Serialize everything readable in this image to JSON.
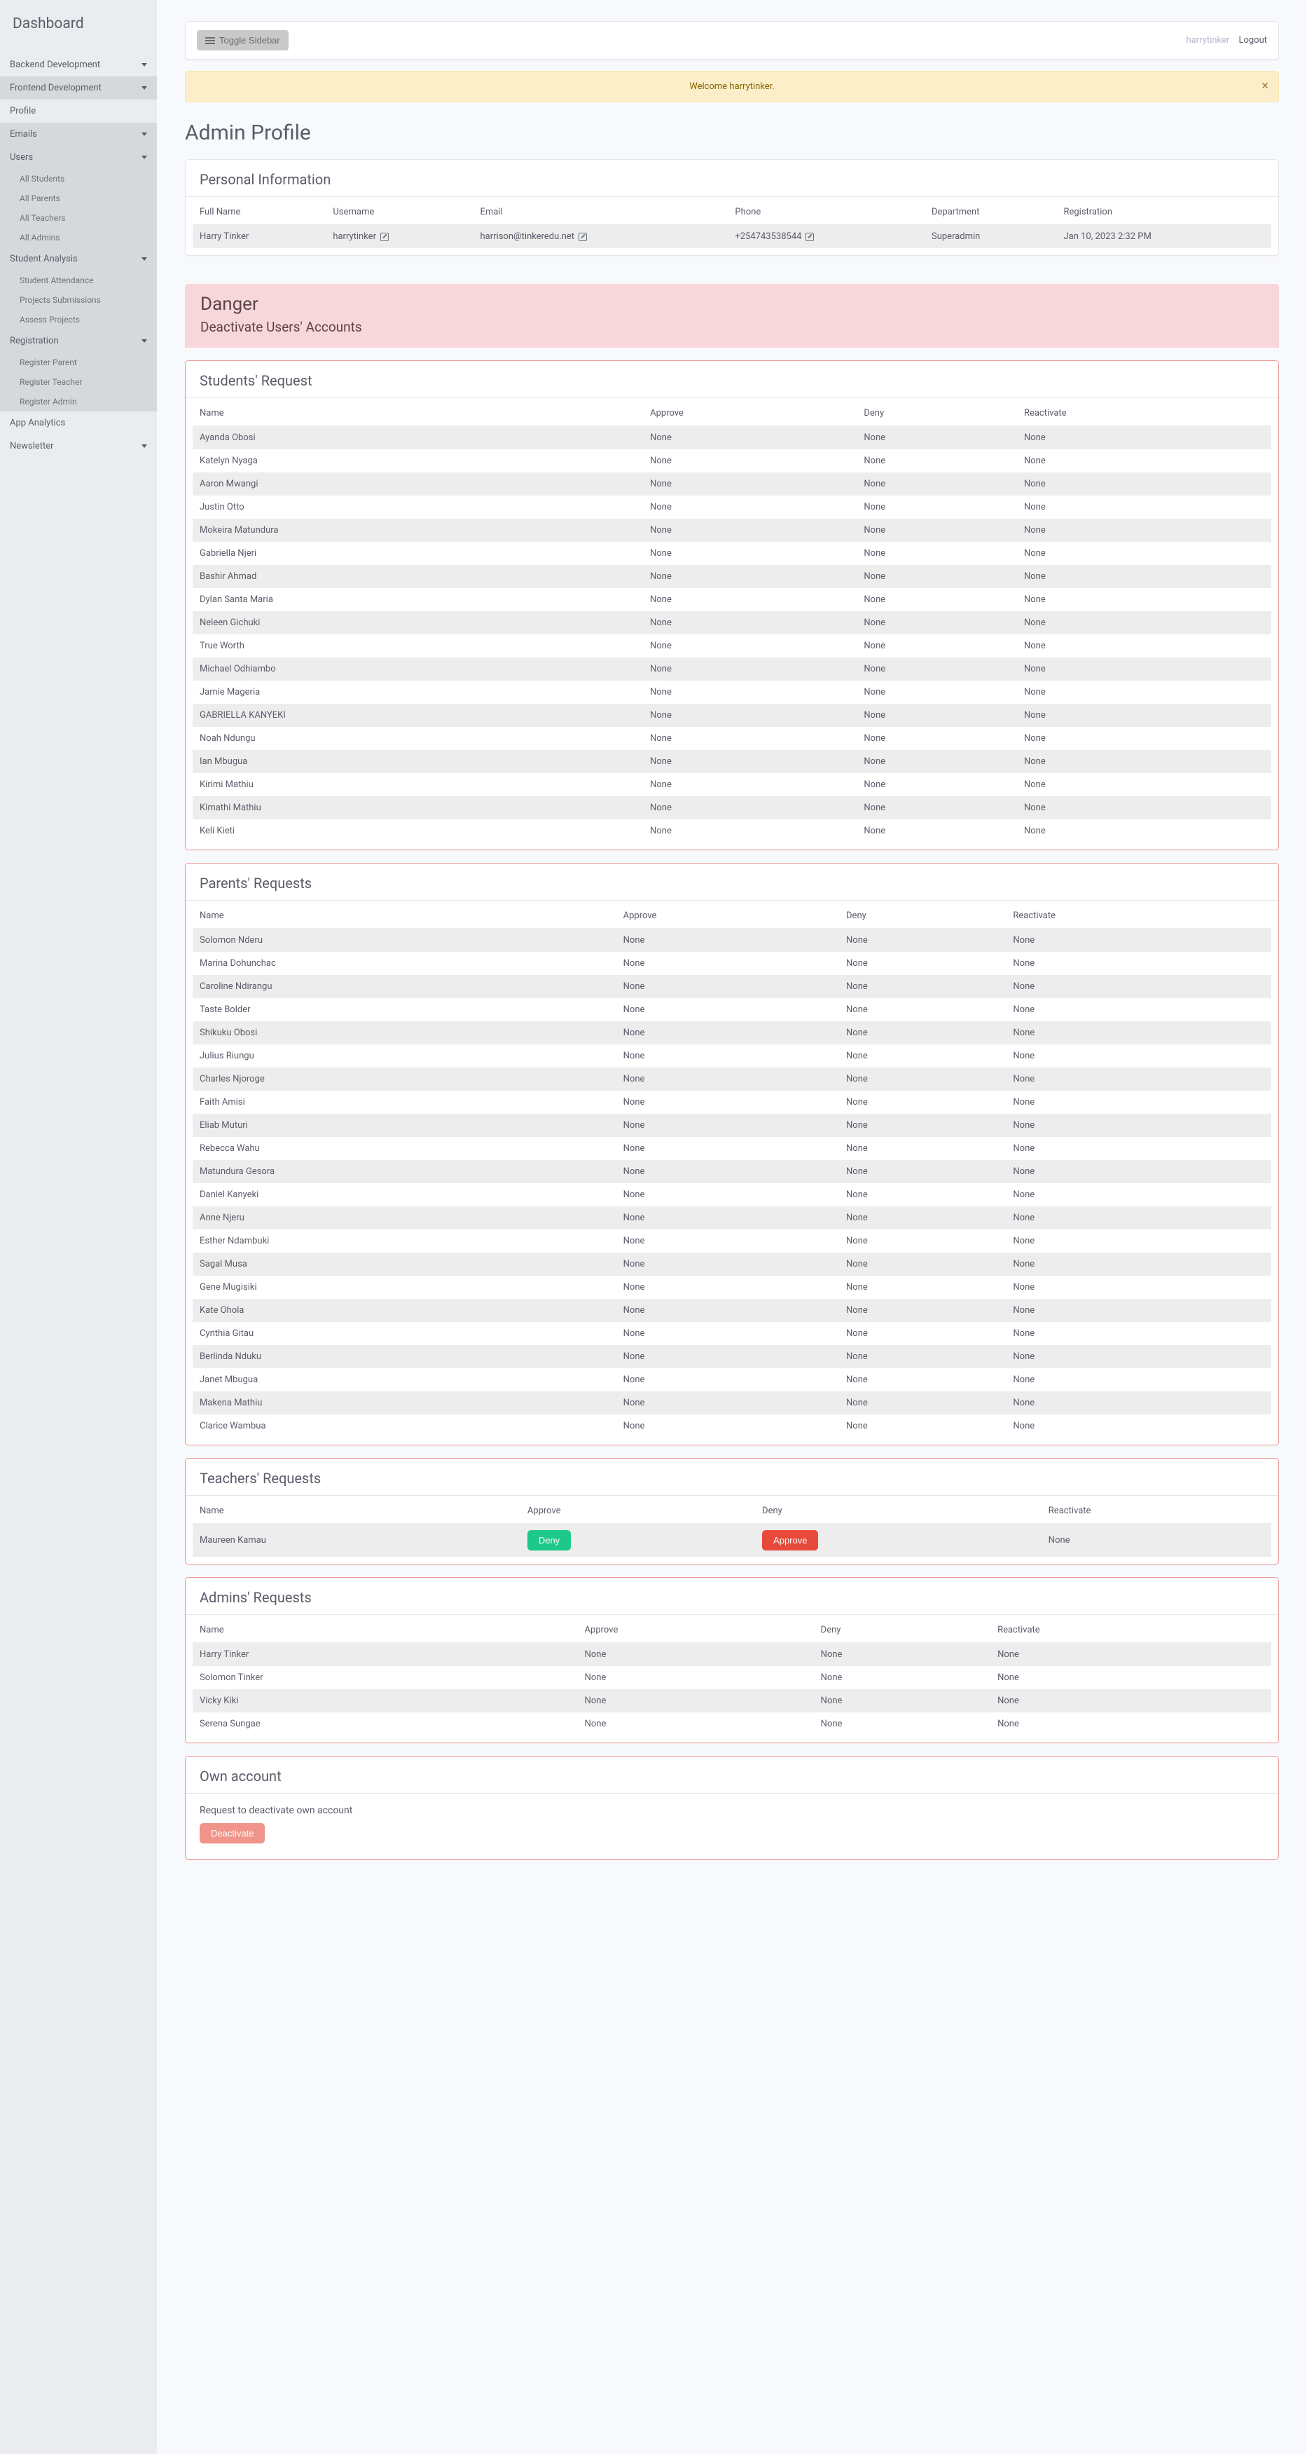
{
  "sidebar": {
    "brand": "Dashboard",
    "items": [
      {
        "label": "Backend Development",
        "caret": true,
        "kind": "plain"
      },
      {
        "label": "Frontend Development",
        "caret": true,
        "kind": "active"
      },
      {
        "label": "Profile",
        "caret": false,
        "kind": "plain"
      },
      {
        "label": "Emails",
        "caret": true,
        "kind": "active"
      },
      {
        "label": "Users",
        "caret": true,
        "kind": "expanded",
        "subs": [
          "All Students",
          "All Parents",
          "All Teachers",
          "All Admins"
        ]
      },
      {
        "label": "Student Analysis",
        "caret": true,
        "kind": "expanded",
        "subs": [
          "Student Attendance",
          "Projects Submissions",
          "Assess Projects"
        ]
      },
      {
        "label": "Registration",
        "caret": true,
        "kind": "expanded",
        "subs": [
          "Register Parent",
          "Register Teacher",
          "Register Admin"
        ]
      },
      {
        "label": "App Analytics",
        "caret": false,
        "kind": "plain"
      },
      {
        "label": "Newsletter",
        "caret": true,
        "kind": "plain"
      }
    ]
  },
  "topbar": {
    "toggle": "Toggle Sidebar",
    "user": "harrytinker",
    "logout": "Logout"
  },
  "alert": {
    "text": "Welcome harrytinker."
  },
  "page_title": "Admin Profile",
  "personal_info": {
    "title": "Personal Information",
    "headers": [
      "Full Name",
      "Username",
      "Email",
      "Phone",
      "Department",
      "Registration"
    ],
    "row": {
      "full_name": "Harry Tinker",
      "username": "harrytinker",
      "email": "harrison@tinkeredu.net",
      "phone": "+254743538544",
      "department": "Superadmin",
      "registration": "Jan 10, 2023 2:32 PM"
    }
  },
  "danger": {
    "title": "Danger",
    "subtitle": "Deactivate Users' Accounts"
  },
  "students": {
    "title": "Students' Request",
    "headers": [
      "Name",
      "Approve",
      "Deny",
      "Reactivate"
    ],
    "rows": [
      {
        "name": "Ayanda Obosi",
        "approve": "None",
        "deny": "None",
        "reactivate": "None"
      },
      {
        "name": "Katelyn Nyaga",
        "approve": "None",
        "deny": "None",
        "reactivate": "None"
      },
      {
        "name": "Aaron Mwangi",
        "approve": "None",
        "deny": "None",
        "reactivate": "None"
      },
      {
        "name": "Justin Otto",
        "approve": "None",
        "deny": "None",
        "reactivate": "None"
      },
      {
        "name": "Mokeira Matundura",
        "approve": "None",
        "deny": "None",
        "reactivate": "None"
      },
      {
        "name": "Gabriella Njeri",
        "approve": "None",
        "deny": "None",
        "reactivate": "None"
      },
      {
        "name": "Bashir Ahmad",
        "approve": "None",
        "deny": "None",
        "reactivate": "None"
      },
      {
        "name": "Dylan Santa Maria",
        "approve": "None",
        "deny": "None",
        "reactivate": "None"
      },
      {
        "name": "Neleen Gichuki",
        "approve": "None",
        "deny": "None",
        "reactivate": "None"
      },
      {
        "name": "True Worth",
        "approve": "None",
        "deny": "None",
        "reactivate": "None"
      },
      {
        "name": "Michael Odhiambo",
        "approve": "None",
        "deny": "None",
        "reactivate": "None"
      },
      {
        "name": "Jamie Mageria",
        "approve": "None",
        "deny": "None",
        "reactivate": "None"
      },
      {
        "name": "GABRIELLA KANYEKI",
        "approve": "None",
        "deny": "None",
        "reactivate": "None"
      },
      {
        "name": "Noah Ndungu",
        "approve": "None",
        "deny": "None",
        "reactivate": "None"
      },
      {
        "name": "Ian Mbugua",
        "approve": "None",
        "deny": "None",
        "reactivate": "None"
      },
      {
        "name": "Kirimi Mathiu",
        "approve": "None",
        "deny": "None",
        "reactivate": "None"
      },
      {
        "name": "Kimathi Mathiu",
        "approve": "None",
        "deny": "None",
        "reactivate": "None"
      },
      {
        "name": "Keli Kieti",
        "approve": "None",
        "deny": "None",
        "reactivate": "None"
      }
    ]
  },
  "parents": {
    "title": "Parents' Requests",
    "headers": [
      "Name",
      "Approve",
      "Deny",
      "Reactivate"
    ],
    "rows": [
      {
        "name": "Solomon Nderu",
        "approve": "None",
        "deny": "None",
        "reactivate": "None"
      },
      {
        "name": "Marina Dohunchac",
        "approve": "None",
        "deny": "None",
        "reactivate": "None"
      },
      {
        "name": "Caroline Ndirangu",
        "approve": "None",
        "deny": "None",
        "reactivate": "None"
      },
      {
        "name": "Taste Bolder",
        "approve": "None",
        "deny": "None",
        "reactivate": "None"
      },
      {
        "name": "Shikuku Obosi",
        "approve": "None",
        "deny": "None",
        "reactivate": "None"
      },
      {
        "name": "Julius Riungu",
        "approve": "None",
        "deny": "None",
        "reactivate": "None"
      },
      {
        "name": "Charles Njoroge",
        "approve": "None",
        "deny": "None",
        "reactivate": "None"
      },
      {
        "name": "Faith Amisi",
        "approve": "None",
        "deny": "None",
        "reactivate": "None"
      },
      {
        "name": "Eliab Muturi",
        "approve": "None",
        "deny": "None",
        "reactivate": "None"
      },
      {
        "name": "Rebecca Wahu",
        "approve": "None",
        "deny": "None",
        "reactivate": "None"
      },
      {
        "name": "Matundura Gesora",
        "approve": "None",
        "deny": "None",
        "reactivate": "None"
      },
      {
        "name": "Daniel Kanyeki",
        "approve": "None",
        "deny": "None",
        "reactivate": "None"
      },
      {
        "name": "Anne Njeru",
        "approve": "None",
        "deny": "None",
        "reactivate": "None"
      },
      {
        "name": "Esther Ndambuki",
        "approve": "None",
        "deny": "None",
        "reactivate": "None"
      },
      {
        "name": "Sagal Musa",
        "approve": "None",
        "deny": "None",
        "reactivate": "None"
      },
      {
        "name": "Gene Mugisiki",
        "approve": "None",
        "deny": "None",
        "reactivate": "None"
      },
      {
        "name": "Kate Ohola",
        "approve": "None",
        "deny": "None",
        "reactivate": "None"
      },
      {
        "name": "Cynthia Gitau",
        "approve": "None",
        "deny": "None",
        "reactivate": "None"
      },
      {
        "name": "Berlinda Nduku",
        "approve": "None",
        "deny": "None",
        "reactivate": "None"
      },
      {
        "name": "Janet Mbugua",
        "approve": "None",
        "deny": "None",
        "reactivate": "None"
      },
      {
        "name": "Makena Mathiu",
        "approve": "None",
        "deny": "None",
        "reactivate": "None"
      },
      {
        "name": "Clarice Wambua",
        "approve": "None",
        "deny": "None",
        "reactivate": "None"
      }
    ]
  },
  "teachers": {
    "title": "Teachers' Requests",
    "headers": [
      "Name",
      "Approve",
      "Deny",
      "Reactivate"
    ],
    "rows": [
      {
        "name": "Maureen Kamau",
        "approve_btn": "Deny",
        "deny_btn": "Approve",
        "reactivate": "None"
      }
    ]
  },
  "admins": {
    "title": "Admins' Requests",
    "headers": [
      "Name",
      "Approve",
      "Deny",
      "Reactivate"
    ],
    "rows": [
      {
        "name": "Harry Tinker",
        "approve": "None",
        "deny": "None",
        "reactivate": "None"
      },
      {
        "name": "Solomon Tinker",
        "approve": "None",
        "deny": "None",
        "reactivate": "None"
      },
      {
        "name": "Vicky Kiki",
        "approve": "None",
        "deny": "None",
        "reactivate": "None"
      },
      {
        "name": "Serena Sungae",
        "approve": "None",
        "deny": "None",
        "reactivate": "None"
      }
    ]
  },
  "own": {
    "title": "Own account",
    "text": "Request to deactivate own account",
    "button": "Deactivate"
  }
}
